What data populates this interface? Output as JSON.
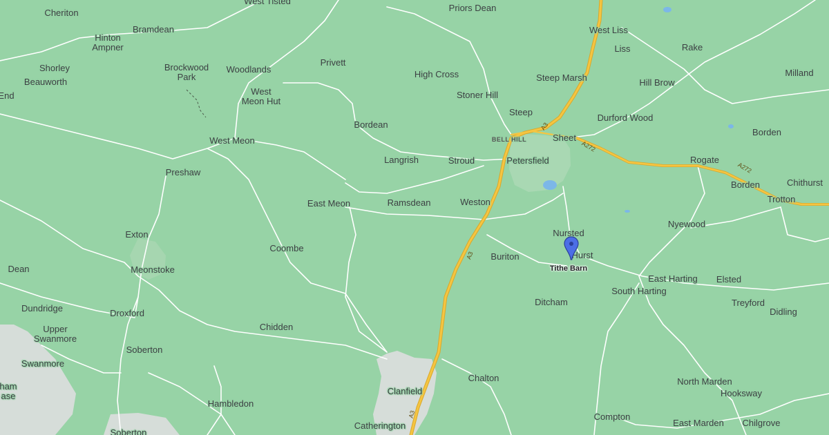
{
  "map": {
    "colors": {
      "land": "#97d3a6",
      "road": "#ffffff",
      "highway": "#f5c542",
      "highway_edge": "#d9a82a",
      "urban": "#d6ddd9",
      "water": "#7cb7e8",
      "marker": "#4c6ee6"
    },
    "marker": {
      "label": "Tithe Barn",
      "icon": "map-pin-icon"
    },
    "roads": [
      {
        "label": "A3"
      },
      {
        "label": "A3"
      },
      {
        "label": "A3"
      },
      {
        "label": "A272"
      },
      {
        "label": "A272"
      }
    ],
    "places": [
      {
        "name": "Cheriton"
      },
      {
        "name": "West Tisted"
      },
      {
        "name": "Priors Dean"
      },
      {
        "name": "West Liss"
      },
      {
        "name": "Bramdean"
      },
      {
        "name": "Hinton\nAmpner"
      },
      {
        "name": "Liss"
      },
      {
        "name": "Rake"
      },
      {
        "name": "Shorley"
      },
      {
        "name": "Brockwood\nPark"
      },
      {
        "name": "Woodlands"
      },
      {
        "name": "Privett"
      },
      {
        "name": "High Cross"
      },
      {
        "name": "Steep Marsh"
      },
      {
        "name": "Milland"
      },
      {
        "name": "Beauworth"
      },
      {
        "name": "Hill Brow"
      },
      {
        "name": "End"
      },
      {
        "name": "West\nMeon Hut"
      },
      {
        "name": "Stoner Hill"
      },
      {
        "name": "Steep"
      },
      {
        "name": "Durford Wood"
      },
      {
        "name": "Bordean"
      },
      {
        "name": "Borden"
      },
      {
        "name": "BELL HILL"
      },
      {
        "name": "Sheet"
      },
      {
        "name": "West Meon"
      },
      {
        "name": "Langrish"
      },
      {
        "name": "Stroud"
      },
      {
        "name": "Petersfield"
      },
      {
        "name": "Rogate"
      },
      {
        "name": "Preshaw"
      },
      {
        "name": "Borden"
      },
      {
        "name": "Chithurst"
      },
      {
        "name": "East Meon"
      },
      {
        "name": "Ramsdean"
      },
      {
        "name": "Weston"
      },
      {
        "name": "Trotton"
      },
      {
        "name": "Nyewood"
      },
      {
        "name": "Exton"
      },
      {
        "name": "Nursted"
      },
      {
        "name": "Coombe"
      },
      {
        "name": "Buriton"
      },
      {
        "name": "Hurst"
      },
      {
        "name": "Dean"
      },
      {
        "name": "Meonstoke"
      },
      {
        "name": "East Harting"
      },
      {
        "name": "Elsted"
      },
      {
        "name": "South Harting"
      },
      {
        "name": "Ditcham"
      },
      {
        "name": "Treyford"
      },
      {
        "name": "Dundridge"
      },
      {
        "name": "Droxford"
      },
      {
        "name": "Didling"
      },
      {
        "name": "Upper\nSwanmore"
      },
      {
        "name": "Chidden"
      },
      {
        "name": "Soberton"
      },
      {
        "name": "Swanmore"
      },
      {
        "name": "Chalton"
      },
      {
        "name": "North Marden"
      },
      {
        "name": "Clanfield"
      },
      {
        "name": "Hooksway"
      },
      {
        "name": "ham\nase"
      },
      {
        "name": "Hambledon"
      },
      {
        "name": "Compton"
      },
      {
        "name": "East Marden"
      },
      {
        "name": "Chilgrove"
      },
      {
        "name": "Catherington"
      },
      {
        "name": "Soberton"
      }
    ]
  }
}
